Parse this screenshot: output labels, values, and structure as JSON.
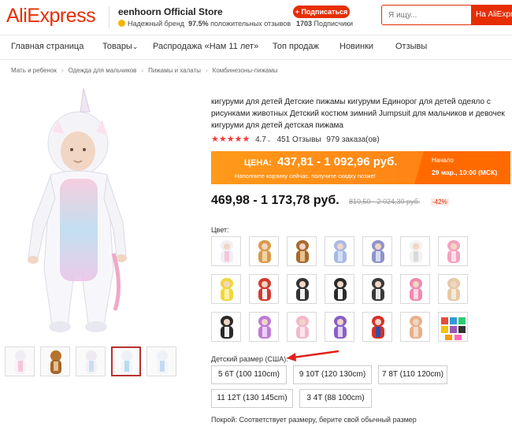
{
  "header": {
    "logo": "AliExpress",
    "store_name": "eenhoorn Official Store",
    "brand_label": "Надежный бренд",
    "positive_percent": "97.5%",
    "positive_text": "положительных отзывов",
    "subscribe_label": "+ Подписаться",
    "followers_count": "1703",
    "followers_label": "Подписчики",
    "search_placeholder": "Я ищу...",
    "search_button": "На AliExpress",
    "accent_color": "#e62e04"
  },
  "nav": {
    "items": [
      "Главная страница",
      "Товары",
      "Распродажа «Нам 11 лет»",
      "Топ продаж",
      "Новинки",
      "Отзывы"
    ]
  },
  "breadcrumb": [
    "Мать и ребенок",
    "Одежда для мальчиков",
    "Пижамы и халаты",
    "Комбинезоны-пижамы"
  ],
  "product": {
    "title": "кигуруми для детей Детские пижамы кигуруми Единорог для детей одеяло с рисунками животных Детский костюм зимний Jumpsuit для мальчиков и девочек кигуруми для детей детская пижама",
    "stars": "★★★★★",
    "rating": "4.7",
    "reviews": "451 Отзывы",
    "orders": "979 заказа(ов)",
    "promo": {
      "price_label": "ЦЕНА:",
      "price": "437,81 - 1 092,96 руб.",
      "note": "Наполните корзину сейчас, получите скидку позже!",
      "start_label": "Начало",
      "start_date": "29 мар., 10:00 (МСК)"
    },
    "price": "469,98 - 1 173,78 руб.",
    "old_price": "810,50 - 2 024,30 руб.",
    "discount": "-42%",
    "color_label": "Цвет:",
    "size_label": "Детский размер (США):",
    "sizes": [
      "5 6T (100 110cm)",
      "9 10T (120 130cm)",
      "7 8T (110 120cm)",
      "11 12T (130 145cm)",
      "3 4T (88 100cm)"
    ],
    "fit_note": "Покрой: Соответствует размеру, берите свой обычный размер"
  }
}
